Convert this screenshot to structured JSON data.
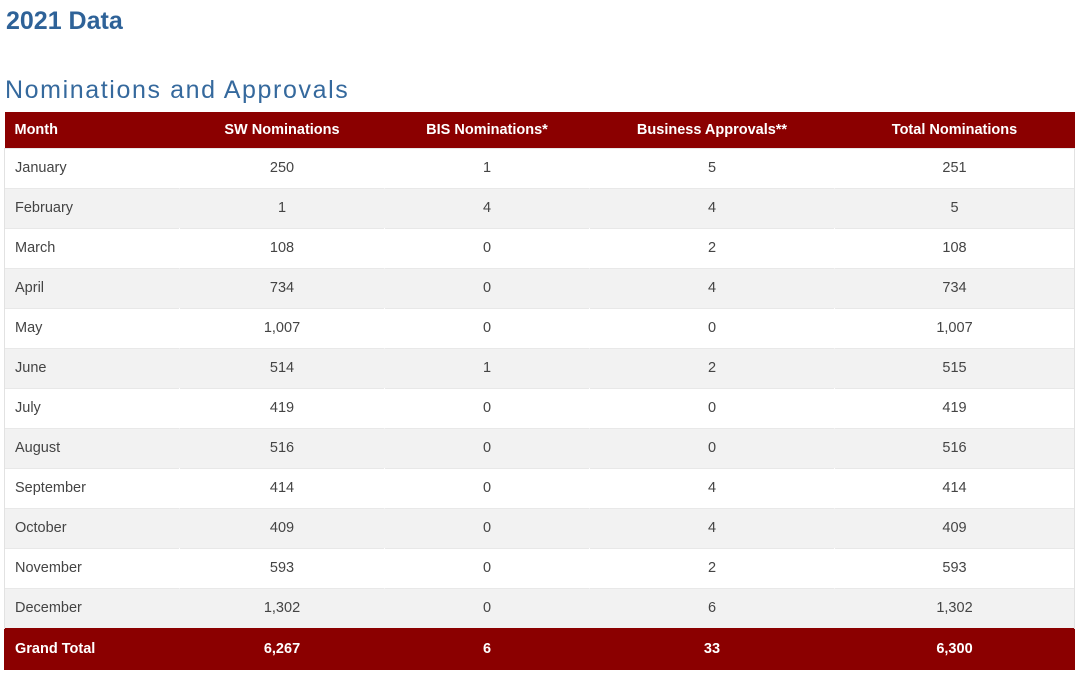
{
  "page_title": "2021 Data",
  "section_title": "Nominations and Approvals",
  "colors": {
    "title_blue": "#2e6298",
    "section_blue": "#35699d",
    "header_red": "#8b0000",
    "stripe_gray": "#f2f2f2",
    "body_text": "#444444"
  },
  "table": {
    "columns": [
      {
        "label": "Month",
        "align": "left"
      },
      {
        "label": "SW Nominations",
        "align": "center"
      },
      {
        "label": "BIS Nominations*",
        "align": "center"
      },
      {
        "label": "Business Approvals**",
        "align": "center"
      },
      {
        "label": "Total Nominations",
        "align": "center"
      }
    ],
    "rows": [
      {
        "month": "January",
        "sw": "250",
        "bis": "1",
        "approvals": "5",
        "total": "251"
      },
      {
        "month": "February",
        "sw": "1",
        "bis": "4",
        "approvals": "4",
        "total": "5"
      },
      {
        "month": "March",
        "sw": "108",
        "bis": "0",
        "approvals": "2",
        "total": "108"
      },
      {
        "month": "April",
        "sw": "734",
        "bis": "0",
        "approvals": "4",
        "total": "734"
      },
      {
        "month": "May",
        "sw": "1,007",
        "bis": "0",
        "approvals": "0",
        "total": "1,007"
      },
      {
        "month": "June",
        "sw": "514",
        "bis": "1",
        "approvals": "2",
        "total": "515"
      },
      {
        "month": "July",
        "sw": "419",
        "bis": "0",
        "approvals": "0",
        "total": "419"
      },
      {
        "month": "August",
        "sw": "516",
        "bis": "0",
        "approvals": "0",
        "total": "516"
      },
      {
        "month": "September",
        "sw": "414",
        "bis": "0",
        "approvals": "4",
        "total": "414"
      },
      {
        "month": "October",
        "sw": "409",
        "bis": "0",
        "approvals": "4",
        "total": "409"
      },
      {
        "month": "November",
        "sw": "593",
        "bis": "0",
        "approvals": "2",
        "total": "593"
      },
      {
        "month": "December",
        "sw": "1,302",
        "bis": "0",
        "approvals": "6",
        "total": "1,302"
      }
    ],
    "total_row": {
      "month": "Grand Total",
      "sw": "6,267",
      "bis": "6",
      "approvals": "33",
      "total": "6,300"
    }
  },
  "chart_data": {
    "type": "table",
    "title": "Nominations and Approvals",
    "categories": [
      "January",
      "February",
      "March",
      "April",
      "May",
      "June",
      "July",
      "August",
      "September",
      "October",
      "November",
      "December"
    ],
    "series": [
      {
        "name": "SW Nominations",
        "values": [
          250,
          1,
          108,
          734,
          1007,
          514,
          419,
          516,
          414,
          409,
          593,
          1302
        ],
        "total": 6267
      },
      {
        "name": "BIS Nominations*",
        "values": [
          1,
          4,
          0,
          0,
          0,
          1,
          0,
          0,
          0,
          0,
          0,
          0
        ],
        "total": 6
      },
      {
        "name": "Business Approvals**",
        "values": [
          5,
          4,
          2,
          4,
          0,
          2,
          0,
          0,
          4,
          4,
          2,
          6
        ],
        "total": 33
      },
      {
        "name": "Total Nominations",
        "values": [
          251,
          5,
          108,
          734,
          1007,
          515,
          419,
          516,
          414,
          409,
          593,
          1302
        ],
        "total": 6300
      }
    ],
    "xlabel": "Month",
    "ylabel": ""
  }
}
